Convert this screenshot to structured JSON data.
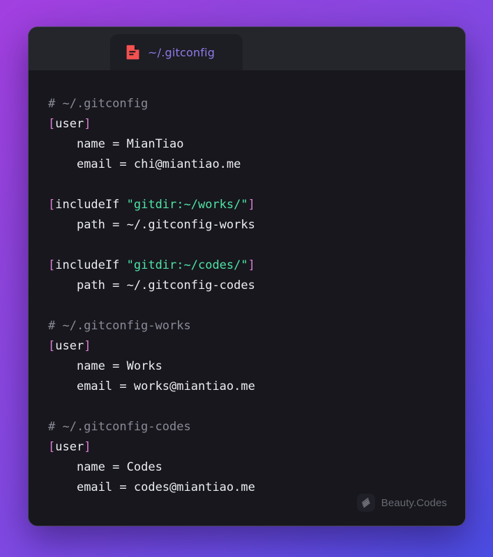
{
  "window": {
    "traffic_lights": [
      {
        "name": "close",
        "color": "#ff5f57"
      },
      {
        "name": "minimize",
        "color": "#febc2e"
      },
      {
        "name": "maximize",
        "color": "#28c840"
      }
    ],
    "tab": {
      "label": "~/.gitconfig",
      "icon": "file-document-icon",
      "icon_color": "#f4514f",
      "label_color": "#8d7ce8"
    }
  },
  "editor": {
    "language": "gitconfig",
    "theme_colors": {
      "background": "#17171d",
      "titlebar": "#25252c",
      "tab_background": "#1d1d24",
      "comment": "#8b8b99",
      "bracket": "#e07fd4",
      "string": "#4fe3a6",
      "text": "#e4e4ec"
    },
    "lines": [
      {
        "type": "comment",
        "text": "# ~/.gitconfig"
      },
      {
        "type": "section",
        "text": "[user]"
      },
      {
        "type": "pair",
        "key": "name",
        "value": "MianTiao"
      },
      {
        "type": "pair",
        "key": "email",
        "value": "chi@miantiao.me"
      },
      {
        "type": "blank",
        "text": ""
      },
      {
        "type": "section_string",
        "name": "includeIf",
        "string": "\"gitdir:~/works/\""
      },
      {
        "type": "pair",
        "key": "path",
        "value": "~/.gitconfig-works"
      },
      {
        "type": "blank",
        "text": ""
      },
      {
        "type": "section_string",
        "name": "includeIf",
        "string": "\"gitdir:~/codes/\""
      },
      {
        "type": "pair",
        "key": "path",
        "value": "~/.gitconfig-codes"
      },
      {
        "type": "blank",
        "text": ""
      },
      {
        "type": "comment",
        "text": "# ~/.gitconfig-works"
      },
      {
        "type": "section",
        "text": "[user]"
      },
      {
        "type": "pair",
        "key": "name",
        "value": "Works"
      },
      {
        "type": "pair",
        "key": "email",
        "value": "works@miantiao.me"
      },
      {
        "type": "blank",
        "text": ""
      },
      {
        "type": "comment",
        "text": "# ~/.gitconfig-codes"
      },
      {
        "type": "section",
        "text": "[user]"
      },
      {
        "type": "pair",
        "key": "name",
        "value": "Codes"
      },
      {
        "type": "pair",
        "key": "email",
        "value": "codes@miantiao.me"
      }
    ]
  },
  "watermark": {
    "text": "Beauty.Codes",
    "logo": "beauty-codes-logo-icon"
  },
  "background": {
    "gradient_from": "#a33fe0",
    "gradient_to": "#4a4ce2"
  }
}
